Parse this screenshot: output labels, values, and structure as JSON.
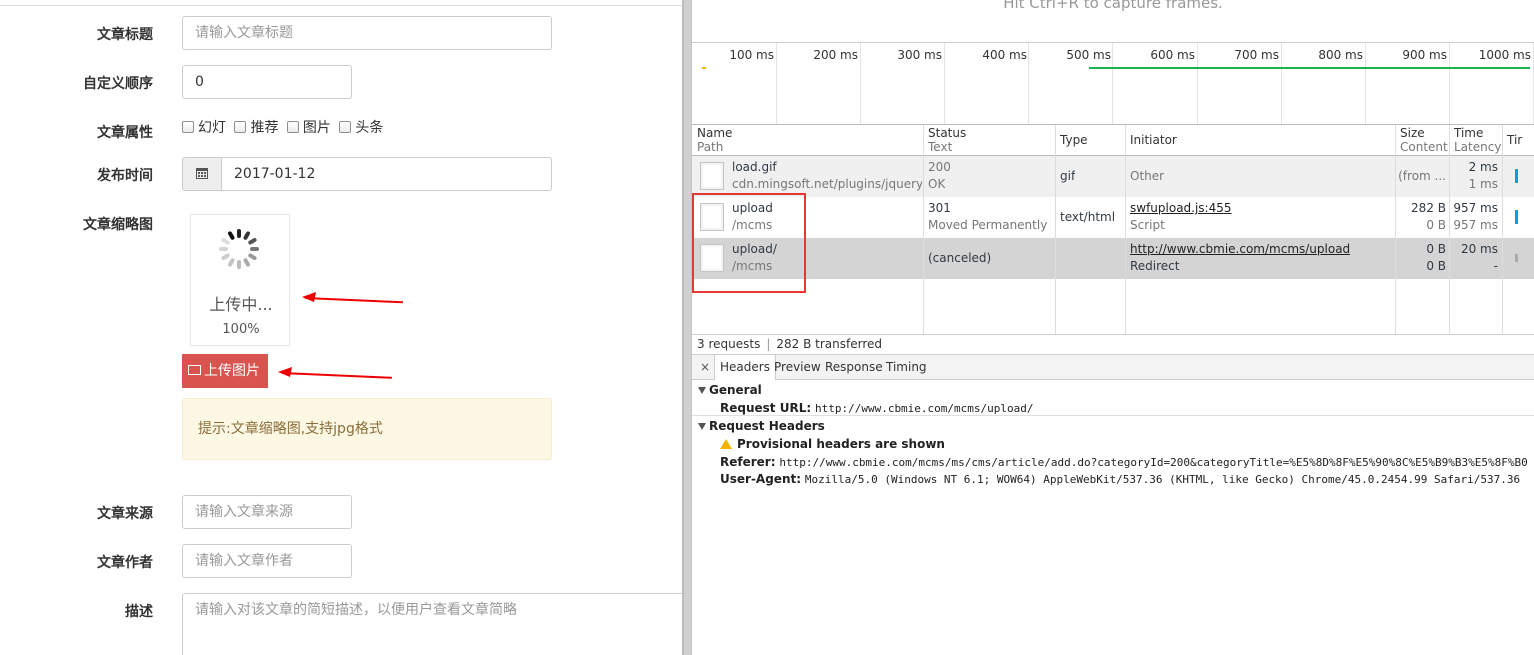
{
  "form": {
    "title_label": "文章标题",
    "title_placeholder": "请输入文章标题",
    "order_label": "自定义顺序",
    "order_value": "0",
    "attr_label": "文章属性",
    "attrs": [
      "幻灯",
      "推荐",
      "图片",
      "头条"
    ],
    "date_label": "发布时间",
    "date_value": "2017-01-12",
    "thumb_label": "文章缩略图",
    "uploading_text": "上传中...",
    "upload_percent": "100%",
    "upload_button": "上传图片",
    "tip_text": "提示:文章缩略图,支持jpg格式",
    "source_label": "文章来源",
    "source_placeholder": "请输入文章来源",
    "author_label": "文章作者",
    "author_placeholder": "请输入文章作者",
    "desc_label": "描述",
    "desc_placeholder": "请输入对该文章的简短描述，以便用户查看文章简略"
  },
  "devtools": {
    "capture_hint": "Hit Ctrl+R to capture frames.",
    "timeline_labels": [
      "100 ms",
      "200 ms",
      "300 ms",
      "400 ms",
      "500 ms",
      "600 ms",
      "700 ms",
      "800 ms",
      "900 ms",
      "1000 ms"
    ],
    "columns": {
      "name": "Name",
      "path": "Path",
      "status": "Status",
      "text": "Text",
      "type": "Type",
      "initiator": "Initiator",
      "size": "Size",
      "content": "Content",
      "time": "Time",
      "latency": "Latency",
      "timeline": "Tir"
    },
    "rows": [
      {
        "name": "load.gif",
        "path": "cdn.mingsoft.net/plugins/jquery.s...",
        "status": "200",
        "status_text": "OK",
        "type": "gif",
        "initiator": "Other",
        "initiator_sub": "",
        "size": "(from ...",
        "content": "",
        "time": "2 ms",
        "latency": "1 ms"
      },
      {
        "name": "upload",
        "path": "/mcms",
        "status": "301",
        "status_text": "Moved Permanently",
        "type": "text/html",
        "initiator": "swfupload.js:455",
        "initiator_sub": "Script",
        "size": "282 B",
        "content": "0 B",
        "time": "957 ms",
        "latency": "957 ms"
      },
      {
        "name": "upload/",
        "path": "/mcms",
        "status": "(canceled)",
        "status_text": "",
        "type": "",
        "initiator": "http://www.cbmie.com/mcms/upload",
        "initiator_sub": "Redirect",
        "size": "0 B",
        "content": "0 B",
        "time": "20 ms",
        "latency": "-"
      }
    ],
    "summary_requests": "3 requests",
    "summary_transferred": "282 B transferred",
    "close_symbol": "×",
    "tabs": [
      "Headers",
      "Preview",
      "Response",
      "Timing"
    ],
    "general_title": "General",
    "request_url_label": "Request URL:",
    "request_url_value": "http://www.cbmie.com/mcms/upload/",
    "request_headers_title": "Request Headers",
    "provisional_text": "Provisional headers are shown",
    "referer_label": "Referer:",
    "referer_value": "http://www.cbmie.com/mcms/ms/cms/article/add.do?categoryId=200&categoryTitle=%E5%8D%8F%E5%90%8C%E5%B9%B3%E5%8F%B0",
    "ua_label": "User-Agent:",
    "ua_value": "Mozilla/5.0 (Windows NT 6.1; WOW64) AppleWebKit/537.36 (KHTML, like Gecko) Chrome/45.0.2454.99 Safari/537.36"
  },
  "colors": {
    "danger": "#d9534f",
    "annotation_red": "#e00000",
    "waterfall_blue": "#0b9be3",
    "timeline_green": "#1bb24f"
  }
}
